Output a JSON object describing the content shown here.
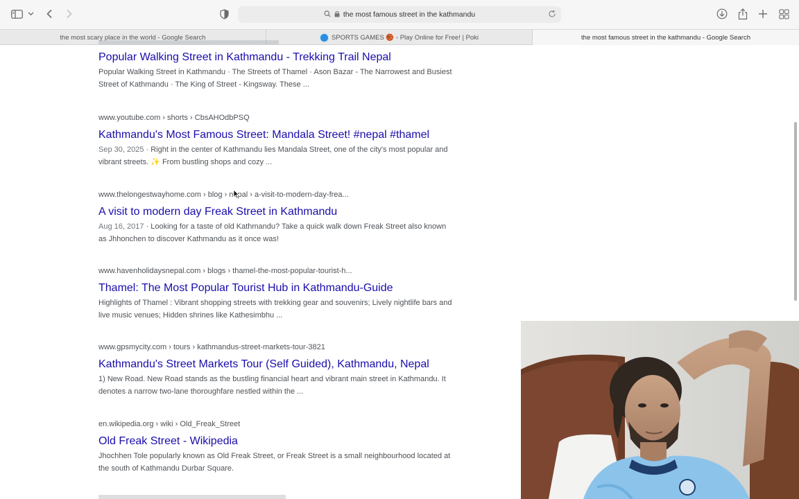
{
  "toolbar": {
    "address_text": "the most famous street in the kathmandu",
    "icons": [
      "sidebar-icon",
      "chevron-down-icon",
      "back-icon",
      "forward-icon",
      "shield-icon",
      "search-icon",
      "lock-icon",
      "reload-icon",
      "download-icon",
      "share-icon",
      "new-tab-icon",
      "tab-overview-icon"
    ]
  },
  "tabs": [
    {
      "label": "the most scary place in the world - Google Search",
      "active": false
    },
    {
      "label": "SPORTS GAMES 🏀 - Play Online for Free! | Poki",
      "active": false
    },
    {
      "label": "the most famous street in the kathmandu - Google Search",
      "active": true
    }
  ],
  "results": [
    {
      "cite": "",
      "title": "Popular Walking Street in Kathmandu - Trekking Trail Nepal",
      "date": "",
      "snippet": "Popular Walking Street in Kathmandu · The Streets of Thamel · Ason Bazar - The Narrowest and Busiest Street of Kathmandu · The King of Street - Kingsway. These ..."
    },
    {
      "cite": "www.youtube.com › shorts › CbsAHOdbPSQ",
      "title": "Kathmandu's Most Famous Street: Mandala Street! #nepal #thamel",
      "date": "Sep 30, 2025",
      "snippet": "Right in the center of Kathmandu lies Mandala Street, one of the city's most popular and vibrant streets. ✨ From bustling shops and cozy ..."
    },
    {
      "cite": "www.thelongestwayhome.com › blog › nepal › a-visit-to-modern-day-frea...",
      "title": "A visit to modern day Freak Street in Kathmandu",
      "date": "Aug 16, 2017",
      "snippet": "Looking for a taste of old Kathmandu? Take a quick walk down Freak Street also known as Jhhonchen to discover Kathmandu as it once was!"
    },
    {
      "cite": "www.havenholidaysnepal.com › blogs › thamel-the-most-popular-tourist-h...",
      "title": "Thamel: The Most Popular Tourist Hub in Kathmandu-Guide",
      "date": "",
      "snippet": "Highlights of Thamel : Vibrant shopping streets with trekking gear and souvenirs; Lively nightlife bars and live music venues; Hidden shrines like Kathesimbhu ..."
    },
    {
      "cite": "www.gpsmycity.com › tours › kathmandus-street-markets-tour-3821",
      "title": "Kathmandu's Street Markets Tour (Self Guided), Kathmandu, Nepal",
      "date": "",
      "snippet": "1) New Road. New Road stands as the bustling financial heart and vibrant main street in Kathmandu. It denotes a narrow two-lane thoroughfare nestled within the ..."
    },
    {
      "cite": "en.wikipedia.org › wiki › Old_Freak_Street",
      "title": "Old Freak Street - Wikipedia",
      "date": "",
      "snippet": "Jhochhen Tole popularly known as Old Freak Street, or Freak Street is a small neighbourhood located at the south of Kathmandu Durbar Square."
    }
  ],
  "colors": {
    "link": "#1a0dab",
    "text": "#4d5156",
    "toolbar_bg": "#f6f6f6"
  }
}
